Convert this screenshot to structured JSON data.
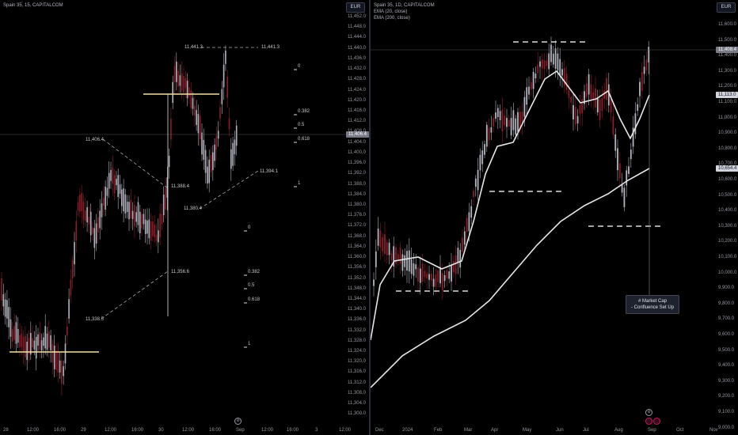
{
  "left": {
    "legend": "Spain 35, 15, CAPITALCOM",
    "currency": "EUR",
    "y_ticks": [
      "11,452.0",
      "11,448.0",
      "11,444.0",
      "11,440.0",
      "11,436.0",
      "11,432.0",
      "11,428.0",
      "11,424.0",
      "11,420.0",
      "11,416.0",
      "11,412.0",
      "11,408.0",
      "11,404.0",
      "11,400.0",
      "11,396.0",
      "11,392.0",
      "11,388.0",
      "11,384.0",
      "11,380.0",
      "11,376.0",
      "11,372.0",
      "11,368.0",
      "11,364.0",
      "11,360.0",
      "11,356.0",
      "11,352.0",
      "11,348.0",
      "11,344.0",
      "11,340.0",
      "11,336.0",
      "11,332.0",
      "11,328.0",
      "11,324.0",
      "11,320.0",
      "11,316.0",
      "11,312.0",
      "11,308.0",
      "11,304.0",
      "11,300.0"
    ],
    "x_ticks": [
      "28",
      "12:00",
      "16:00",
      "29",
      "12:00",
      "16:00",
      "30",
      "12:00",
      "16:00",
      "Sep",
      "12:00",
      "16:00",
      "3",
      "12:00"
    ],
    "last_price": "11,406.4",
    "annotations": {
      "high1": "11,441.3",
      "high2": "11,441.3",
      "a": "11,406.4",
      "b": "11,388.4",
      "c": "11,380.4",
      "d": "11,394.1",
      "e": "11,356.6",
      "f": "11,338.5"
    },
    "fib_upper": [
      "0",
      "0.382",
      "0.5",
      "0.618",
      "1"
    ],
    "fib_lower": [
      "0",
      "0.382",
      "0.5",
      "0.618",
      "1"
    ],
    "nav_icon": "⊘"
  },
  "right": {
    "legend": [
      "Spain 35, 1D, CAPITALCOM",
      "EMA (20, close)",
      "EMA (200, close)"
    ],
    "currency": "EUR",
    "y_ticks": [
      "11,600.0",
      "11,500.0",
      "11,400.0",
      "11,300.0",
      "11,200.0",
      "11,100.0",
      "11,000.0",
      "10,900.0",
      "10,800.0",
      "10,700.0",
      "10,600.0",
      "10,500.0",
      "10,400.0",
      "10,300.0",
      "10,200.0",
      "10,100.0",
      "10,000.0",
      "9,900.0",
      "9,800.0",
      "9,700.0",
      "9,600.0",
      "9,500.0",
      "9,400.0",
      "9,300.0",
      "9,200.0",
      "9,100.0",
      "9,000.0"
    ],
    "x_ticks": [
      "Dec",
      "2024",
      "Feb",
      "Mar",
      "Apr",
      "May",
      "Jun",
      "Jul",
      "Aug",
      "Sep",
      "Oct",
      "Nov"
    ],
    "price_tags": {
      "last": "11,408.4",
      "ema20": "11,113.0",
      "ema200": "10,654.4"
    },
    "tooltip": [
      "# Market Cap",
      "- Confluence Set Up"
    ],
    "nav_icon": "⊘"
  },
  "colors": {
    "bull": "#b2b5be",
    "bear": "#8c1c2a",
    "ema": "#e6e6e6",
    "hline": "#f2e0a6",
    "dash": "#dcdcdc"
  }
}
